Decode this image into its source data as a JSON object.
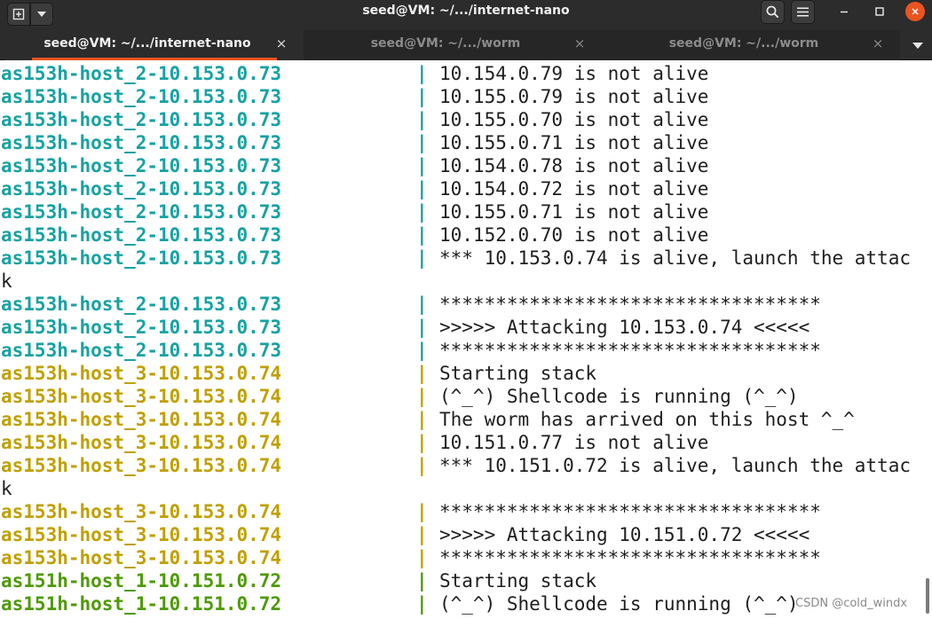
{
  "window": {
    "title": "seed@VM: ~/.../internet-nano",
    "icons": {
      "new_tab": "new-tab-icon",
      "menu": "dropdown-arrow-icon",
      "search": "search-icon",
      "hamburger": "hamburger-menu-icon",
      "minimize": "minimize-icon",
      "maximize": "maximize-icon",
      "close": "close-icon"
    }
  },
  "tabs": [
    {
      "label": "seed@VM: ~/.../internet-nano",
      "close": "×",
      "active": true
    },
    {
      "label": "seed@VM: ~/.../worm",
      "close": "×",
      "active": false
    },
    {
      "label": "seed@VM: ~/.../worm",
      "close": "×",
      "active": false
    }
  ],
  "colors": {
    "host_2": "#17a2a2",
    "host_3": "#c0a000",
    "host_151": "#4e9a06",
    "close_button": "#e95420"
  },
  "terminal": {
    "separator": "|",
    "lines": [
      {
        "prefix": "as153h-host_2-10.153.0.73",
        "color": "teal",
        "message": "10.154.0.79 is not alive"
      },
      {
        "prefix": "as153h-host_2-10.153.0.73",
        "color": "teal",
        "message": "10.155.0.79 is not alive"
      },
      {
        "prefix": "as153h-host_2-10.153.0.73",
        "color": "teal",
        "message": "10.155.0.70 is not alive"
      },
      {
        "prefix": "as153h-host_2-10.153.0.73",
        "color": "teal",
        "message": "10.155.0.71 is not alive"
      },
      {
        "prefix": "as153h-host_2-10.153.0.73",
        "color": "teal",
        "message": "10.154.0.78 is not alive"
      },
      {
        "prefix": "as153h-host_2-10.153.0.73",
        "color": "teal",
        "message": "10.154.0.72 is not alive"
      },
      {
        "prefix": "as153h-host_2-10.153.0.73",
        "color": "teal",
        "message": "10.155.0.71 is not alive"
      },
      {
        "prefix": "as153h-host_2-10.153.0.73",
        "color": "teal",
        "message": "10.152.0.70 is not alive"
      },
      {
        "prefix": "as153h-host_2-10.153.0.73",
        "color": "teal",
        "message": "*** 10.153.0.74 is alive, launch the attac"
      },
      {
        "prefix": "",
        "color": "",
        "message": "k"
      },
      {
        "prefix": "as153h-host_2-10.153.0.73",
        "color": "teal",
        "message": "**********************************"
      },
      {
        "prefix": "as153h-host_2-10.153.0.73",
        "color": "teal",
        "message": ">>>>> Attacking 10.153.0.74 <<<<<"
      },
      {
        "prefix": "as153h-host_2-10.153.0.73",
        "color": "teal",
        "message": "**********************************"
      },
      {
        "prefix": "as153h-host_3-10.153.0.74",
        "color": "olive",
        "message": "Starting stack"
      },
      {
        "prefix": "as153h-host_3-10.153.0.74",
        "color": "olive",
        "message": "(^_^) Shellcode is running (^_^)"
      },
      {
        "prefix": "as153h-host_3-10.153.0.74",
        "color": "olive",
        "message": "The worm has arrived on this host ^_^"
      },
      {
        "prefix": "as153h-host_3-10.153.0.74",
        "color": "olive",
        "message": "10.151.0.77 is not alive"
      },
      {
        "prefix": "as153h-host_3-10.153.0.74",
        "color": "olive",
        "message": "*** 10.151.0.72 is alive, launch the attac"
      },
      {
        "prefix": "",
        "color": "",
        "message": "k"
      },
      {
        "prefix": "as153h-host_3-10.153.0.74",
        "color": "olive",
        "message": "**********************************"
      },
      {
        "prefix": "as153h-host_3-10.153.0.74",
        "color": "olive",
        "message": ">>>>> Attacking 10.151.0.72 <<<<<"
      },
      {
        "prefix": "as153h-host_3-10.153.0.74",
        "color": "olive",
        "message": "**********************************"
      },
      {
        "prefix": "as151h-host_1-10.151.0.72",
        "color": "green",
        "message": "Starting stack"
      },
      {
        "prefix": "as151h-host_1-10.151.0.72",
        "color": "green",
        "message": "(^_^) Shellcode is running (^_^)"
      }
    ]
  },
  "watermark": "CSDN @cold_windx"
}
